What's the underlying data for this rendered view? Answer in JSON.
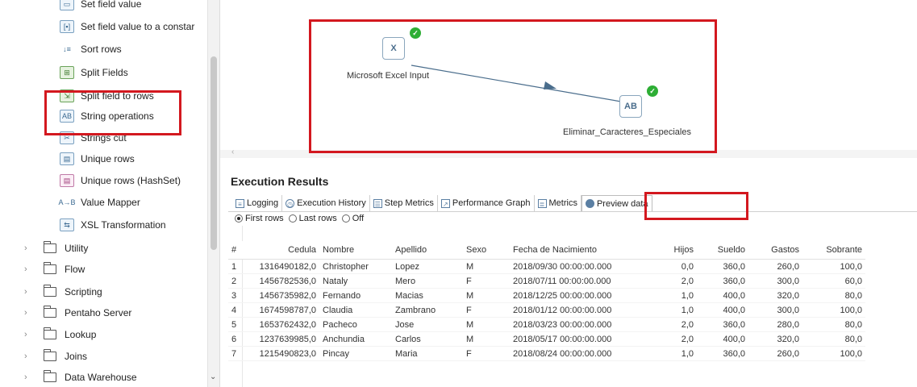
{
  "step_tree": {
    "steps": [
      {
        "label": "Set field value",
        "icon": "set-field-value-icon"
      },
      {
        "label": "Set field value to a constar",
        "icon": "set-field-constant-icon"
      },
      {
        "label": "Sort rows",
        "icon": "sort-rows-icon"
      },
      {
        "label": "Split Fields",
        "icon": "split-fields-icon"
      },
      {
        "label": "Split field to rows",
        "icon": "split-field-rows-icon"
      },
      {
        "label": "String operations",
        "icon": "string-operations-icon"
      },
      {
        "label": "Strings cut",
        "icon": "strings-cut-icon"
      },
      {
        "label": "Unique rows",
        "icon": "unique-rows-icon"
      },
      {
        "label": "Unique rows (HashSet)",
        "icon": "unique-rows-hashset-icon"
      },
      {
        "label": "Value Mapper",
        "icon": "value-mapper-icon"
      },
      {
        "label": "XSL Transformation",
        "icon": "xsl-transformation-icon"
      }
    ],
    "categories": [
      {
        "label": "Utility"
      },
      {
        "label": "Flow"
      },
      {
        "label": "Scripting"
      },
      {
        "label": "Pentaho Server"
      },
      {
        "label": "Lookup"
      },
      {
        "label": "Joins"
      },
      {
        "label": "Data Warehouse"
      }
    ]
  },
  "canvas": {
    "nodes": [
      {
        "label": "Microsoft Excel Input",
        "icon": "excel-input-icon",
        "status": "ok"
      },
      {
        "label": "Eliminar_Caracteres_Especiales",
        "icon": "string-operations-icon",
        "status": "ok"
      }
    ]
  },
  "execution": {
    "title": "Execution Results",
    "tabs": [
      {
        "label": "Logging",
        "icon": "logging-icon"
      },
      {
        "label": "Execution History",
        "icon": "history-icon"
      },
      {
        "label": "Step Metrics",
        "icon": "step-metrics-icon"
      },
      {
        "label": "Performance Graph",
        "icon": "performance-graph-icon"
      },
      {
        "label": "Metrics",
        "icon": "metrics-icon"
      },
      {
        "label": "Preview data",
        "icon": "preview-eye-icon",
        "active": true
      }
    ],
    "radio_options": [
      {
        "label": "First rows",
        "selected": true
      },
      {
        "label": "Last rows",
        "selected": false
      },
      {
        "label": "Off",
        "selected": false
      }
    ]
  },
  "preview_table": {
    "columns": [
      "#",
      "Cedula",
      "Nombre",
      "Apellido",
      "Sexo",
      "Fecha de Nacimiento",
      "Hijos",
      "Sueldo",
      "Gastos",
      "Sobrante"
    ],
    "rows": [
      [
        "1",
        "1316490182,0",
        "Christopher",
        "Lopez",
        "M",
        "2018/09/30 00:00:00.000",
        "0,0",
        "360,0",
        "260,0",
        "100,0"
      ],
      [
        "2",
        "1456782536,0",
        "Nataly",
        "Mero",
        "F",
        "2018/07/11 00:00:00.000",
        "2,0",
        "360,0",
        "300,0",
        "60,0"
      ],
      [
        "3",
        "1456735982,0",
        "Fernando",
        "Macias",
        "M",
        "2018/12/25 00:00:00.000",
        "1,0",
        "400,0",
        "320,0",
        "80,0"
      ],
      [
        "4",
        "1674598787,0",
        "Claudia",
        "Zambrano",
        "F",
        "2018/01/12 00:00:00.000",
        "1,0",
        "400,0",
        "300,0",
        "100,0"
      ],
      [
        "5",
        "1653762432,0",
        "Pacheco",
        "Jose",
        "M",
        "2018/03/23 00:00:00.000",
        "2,0",
        "360,0",
        "280,0",
        "80,0"
      ],
      [
        "6",
        "1237639985,0",
        "Anchundia",
        "Carlos",
        "M",
        "2018/05/17 00:00:00.000",
        "2,0",
        "400,0",
        "320,0",
        "80,0"
      ],
      [
        "7",
        "1215490823,0",
        "Pincay",
        "Maria",
        "F",
        "2018/08/24 00:00:00.000",
        "1,0",
        "360,0",
        "260,0",
        "100,0"
      ]
    ]
  },
  "colors": {
    "highlight": "#d3181f",
    "ok_check": "#2eae35",
    "hop_line": "#4a6d8c"
  }
}
